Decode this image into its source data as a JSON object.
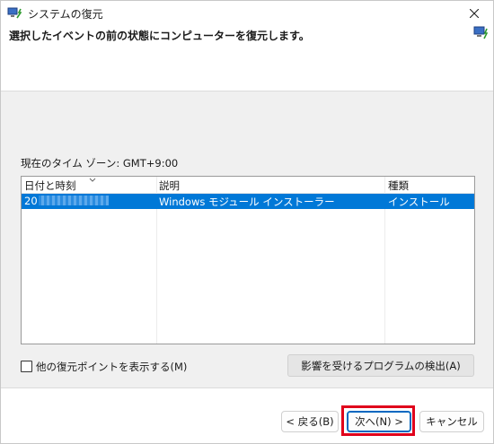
{
  "window": {
    "title": "システムの復元",
    "close_icon": "close-icon"
  },
  "header": {
    "heading": "選択したイベントの前の状態にコンピューターを復元します。",
    "icon": "system-restore-icon"
  },
  "timezone_text": "現在のタイム ゾーン: GMT+9:00",
  "list": {
    "columns": [
      "日付と時刻",
      "説明",
      "種類"
    ],
    "sort_icon": "chevron-down-icon",
    "rows": [
      {
        "datetime_prefix": "20",
        "description": "Windows モジュール インストーラー",
        "type": "インストール",
        "selected": true
      }
    ]
  },
  "show_more_checkbox": {
    "label": "他の復元ポイントを表示する(M)",
    "checked": false
  },
  "detect_button_label": "影響を受けるプログラムの検出(A)",
  "footer": {
    "back_label": "< 戻る(B)",
    "next_label": "次へ(N) >",
    "cancel_label": "キャンセル"
  },
  "colors": {
    "selection": "#0078d7",
    "highlight_box": "#e0001b",
    "body_background": "#f0f0f0"
  }
}
